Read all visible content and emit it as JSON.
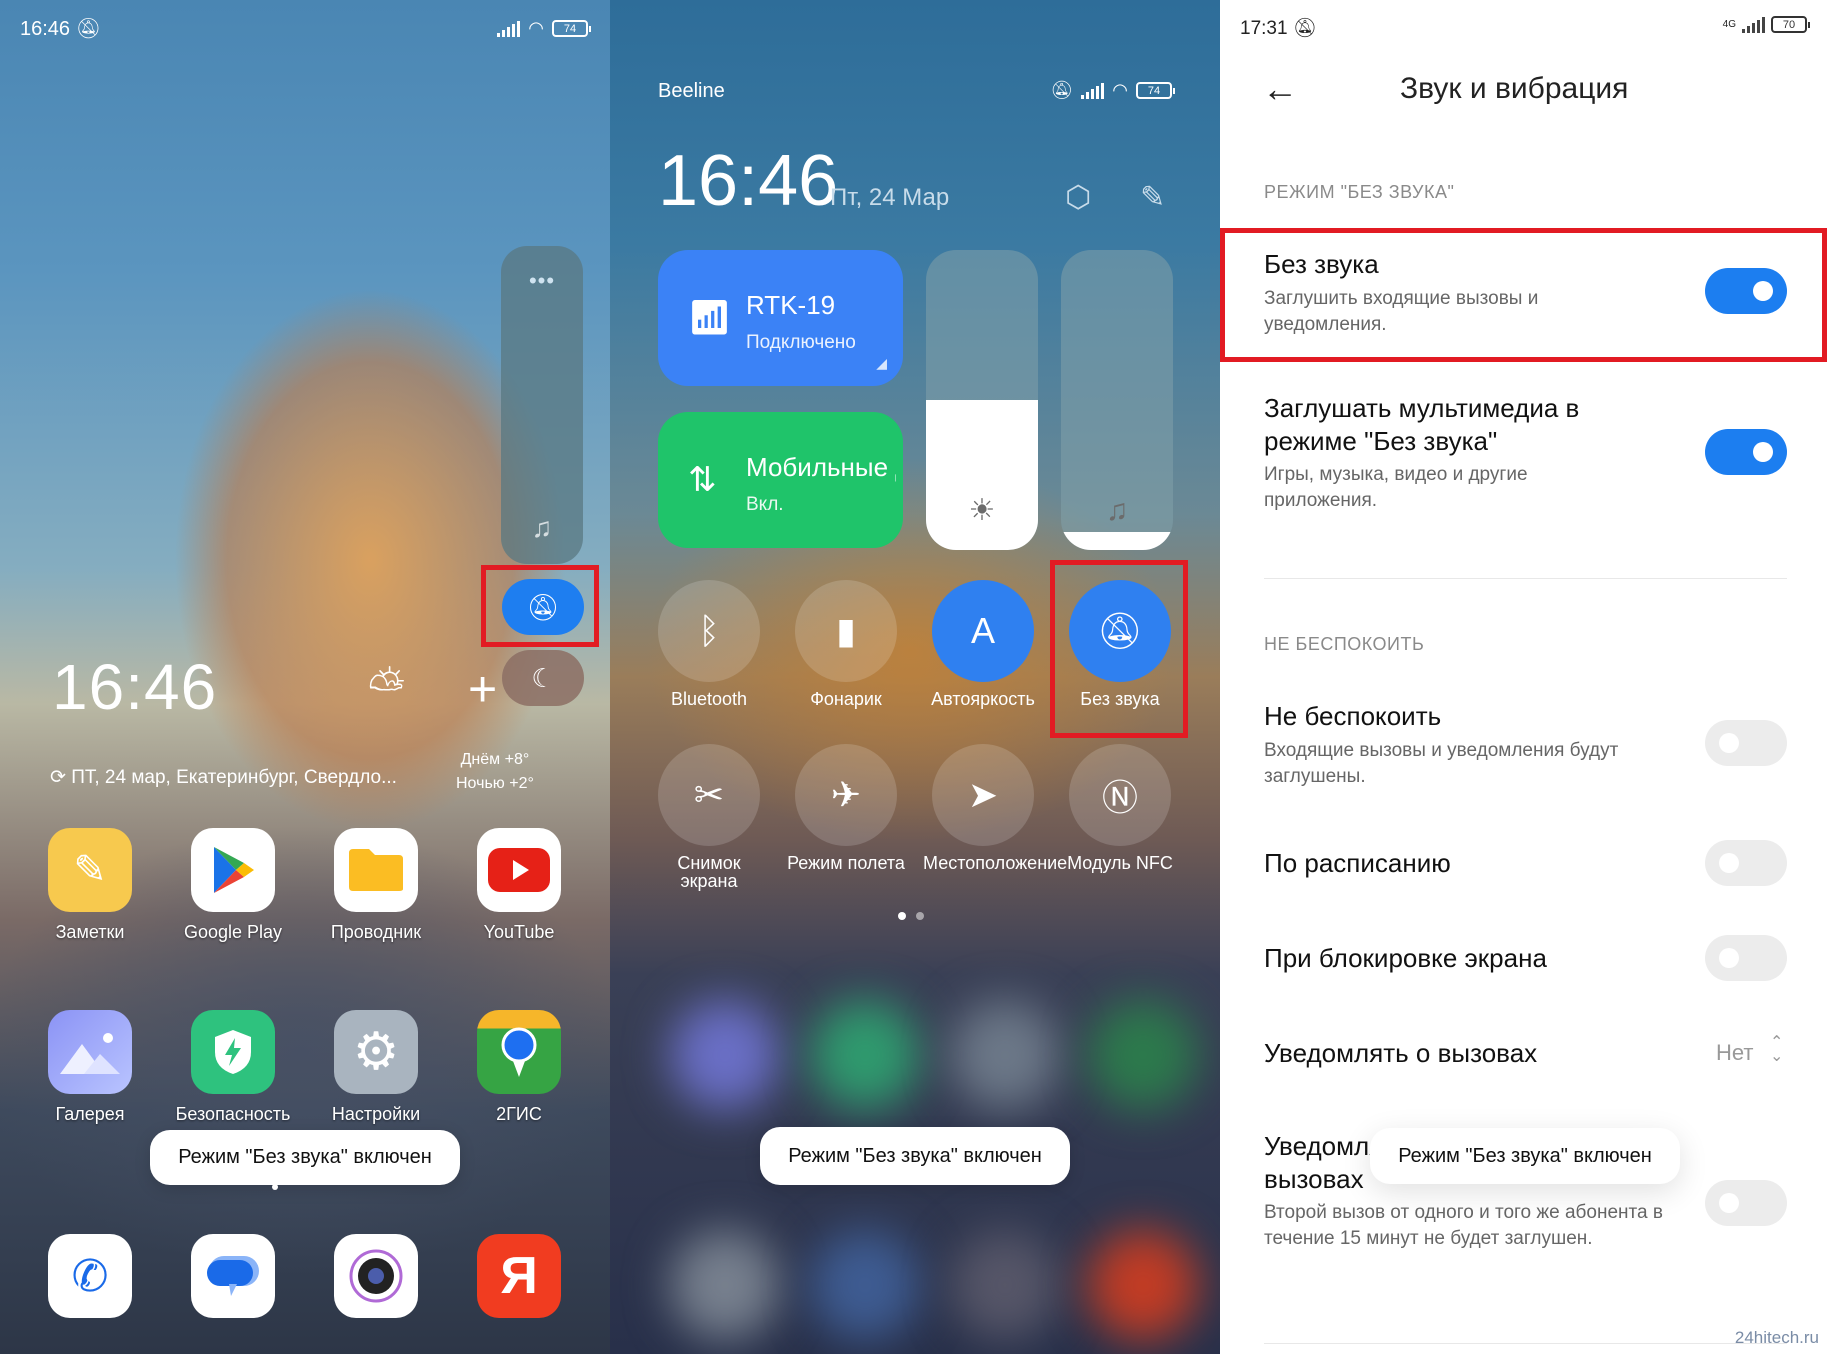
{
  "left_screen": {
    "status_bar": {
      "time": "16:46",
      "battery": "74",
      "icons": [
        "silent-icon",
        "signal-icon",
        "wifi-icon",
        "battery-icon"
      ]
    },
    "volume_panel": {
      "more_label": "•••",
      "icon": "music-muted-icon",
      "silent_button_icon": "bell-off-icon",
      "dnd_button_icon": "moon-icon",
      "silent_active": true
    },
    "clock_widget": {
      "time": "16:46",
      "date_location": "ПТ, 24 мар, Екатеринбург, Свердло...",
      "weather_icon": "partly-cloudy-icon",
      "temp_prefix": "+",
      "day_temp": "Днём +8°",
      "night_temp": "Ночью +2°"
    },
    "apps_row1": [
      {
        "label": "Заметки",
        "icon": "notes-icon",
        "color": "#f7c94e"
      },
      {
        "label": "Google Play",
        "icon": "google-play-icon",
        "color": "#ffffff"
      },
      {
        "label": "Проводник",
        "icon": "folder-icon",
        "color": "#ffffff"
      },
      {
        "label": "YouTube",
        "icon": "youtube-icon",
        "color": "#ffffff"
      }
    ],
    "apps_row2": [
      {
        "label": "Галерея",
        "icon": "gallery-icon",
        "color": "#9aa8f7"
      },
      {
        "label": "Безопасность",
        "icon": "security-icon",
        "color": "#2ec27e"
      },
      {
        "label": "Настройки",
        "icon": "settings-gear-icon",
        "color": "#a9b4bf"
      },
      {
        "label": "2ГИС",
        "icon": "2gis-icon",
        "color": "#36a444"
      }
    ],
    "dock": [
      {
        "label": "Телефон",
        "icon": "phone-icon"
      },
      {
        "label": "Сообщения",
        "icon": "messages-icon"
      },
      {
        "label": "Камера",
        "icon": "camera-icon"
      },
      {
        "label": "Яндекс",
        "icon": "yandex-icon"
      }
    ],
    "toast": "Режим \"Без звука\" включен"
  },
  "middle_screen": {
    "carrier": "Beeline",
    "battery": "74",
    "clock": "16:46",
    "date": "Пт, 24 Мар",
    "wifi_tile": {
      "title": "RTK-19",
      "status": "Подключено",
      "color": "#3b82f6"
    },
    "mobile_tile": {
      "title": "Мобильные данные",
      "status": "Вкл.",
      "color": "#1fc46a"
    },
    "brightness_level": 0.5,
    "volume_level": 0.06,
    "toggles": [
      {
        "label": "Bluetooth",
        "icon": "bluetooth-icon",
        "on": false
      },
      {
        "label": "Фонарик",
        "icon": "flashlight-icon",
        "on": false
      },
      {
        "label": "Автояркость",
        "icon": "auto-brightness-icon",
        "on": true
      },
      {
        "label": "Без звука",
        "icon": "bell-off-icon",
        "on": true
      },
      {
        "label": "Снимок экрана",
        "icon": "screenshot-icon",
        "on": false
      },
      {
        "label": "Режим полета",
        "icon": "airplane-icon",
        "on": false
      },
      {
        "label": "Местоположение",
        "icon": "location-icon",
        "on": false
      },
      {
        "label": "Модуль NFC",
        "icon": "nfc-icon",
        "on": false
      }
    ],
    "page_indicator": {
      "current": 1,
      "total": 2
    },
    "toast": "Режим \"Без звука\" включен"
  },
  "right_screen": {
    "status_bar": {
      "time": "17:31",
      "network": "4G",
      "battery": "70"
    },
    "title": "Звук и вибрация",
    "section_silent": "РЕЖИМ \"БЕЗ ЗВУКА\"",
    "silent": {
      "title": "Без звука",
      "desc": "Заглушить входящие вызовы и уведомления.",
      "on": true
    },
    "mute_media": {
      "title": "Заглушать мультимедиа в режиме \"Без звука\"",
      "desc": "Игры, музыка, видео и другие приложения.",
      "on": true
    },
    "section_dnd": "НЕ БЕСПОКОИТЬ",
    "dnd": {
      "title": "Не беспокоить",
      "desc": "Входящие вызовы и уведомления будут заглушены.",
      "on": false
    },
    "schedule": {
      "title": "По расписанию",
      "on": false
    },
    "lock_screen": {
      "title": "При блокировке экрана",
      "on": false
    },
    "notify_calls": {
      "title": "Уведомлять о вызовах",
      "value": "Нет"
    },
    "repeat_calls": {
      "title": "Уведомлять о повторных вызовах",
      "desc": "Второй вызов от одного и того же абонента в течение 15 минут не будет заглушен.",
      "on": false
    },
    "toast": "Режим \"Без звука\" включен",
    "watermark": "24hitech.ru"
  }
}
